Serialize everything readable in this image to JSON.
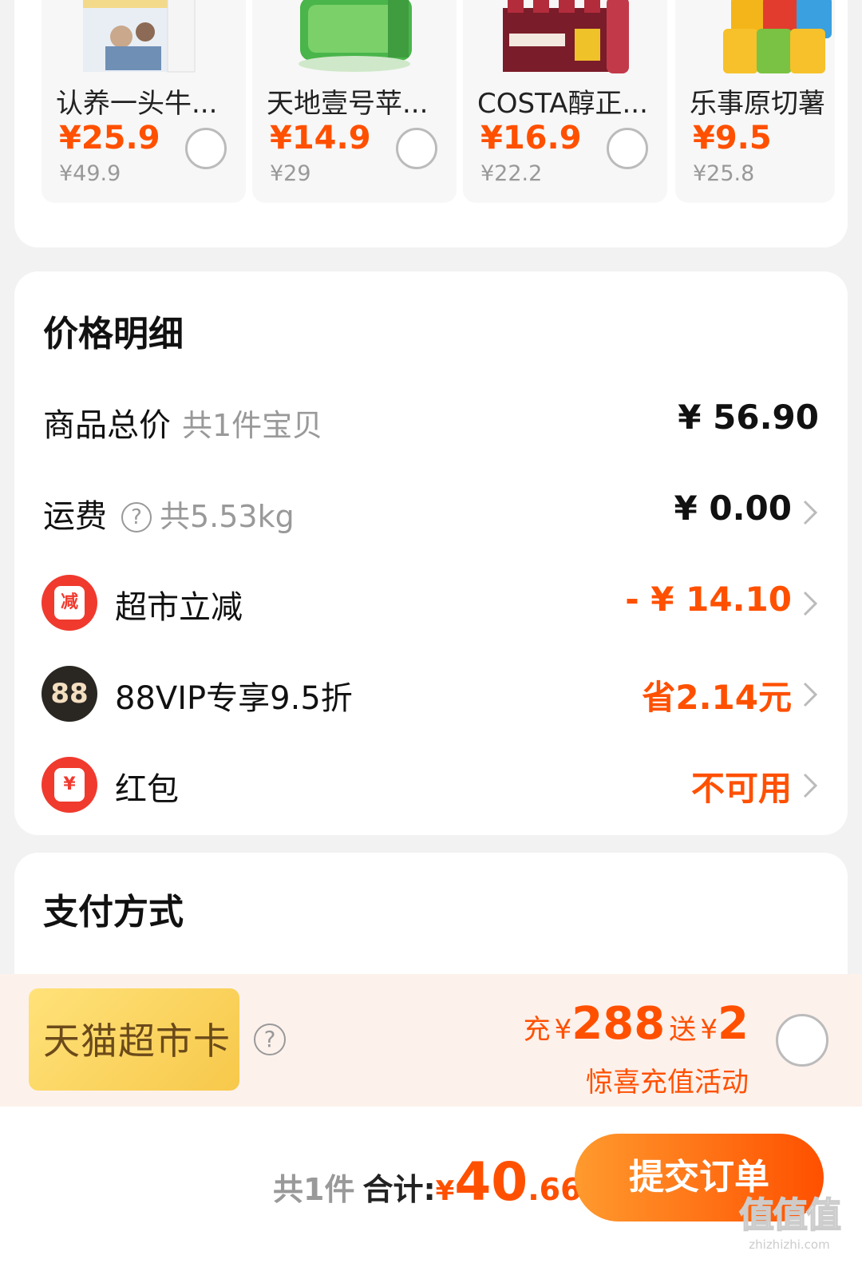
{
  "recommendations": [
    {
      "name": "认养一头牛...",
      "price": "¥25.9",
      "orig": "¥49.9"
    },
    {
      "name": "天地壹号苹...",
      "price": "¥14.9",
      "orig": "¥29"
    },
    {
      "name": "COSTA醇正...",
      "price": "¥16.9",
      "orig": "¥22.2"
    },
    {
      "name": "乐事原切薯",
      "price": "¥9.5",
      "orig": "¥25.8"
    }
  ],
  "detail": {
    "title": "价格明细",
    "goods_label": "商品总价",
    "goods_count": "共1件宝贝",
    "goods_value": "¥ 56.90",
    "ship_label": "运费",
    "ship_q": "?",
    "ship_weight": "共5.53kg",
    "ship_value": "¥ 0.00",
    "market_badge": "减",
    "market_label": "超市立减",
    "market_value": "- ¥ 14.10",
    "vip_badge": "88",
    "vip_label": "88VIP专享9.5折",
    "vip_value": "省2.14元",
    "hb_badge": "¥",
    "hb_label": "红包",
    "hb_value": "不可用"
  },
  "payment": {
    "title": "支付方式"
  },
  "promo": {
    "card_label": "天猫超市卡",
    "q": "?",
    "charge_word": "充",
    "currency": "¥",
    "charge_amount": "288",
    "gift_word": "送",
    "gift_amount": "2",
    "note": "惊喜充值活动"
  },
  "footer": {
    "count": "共1件",
    "total_label": "合计:",
    "currency": "¥",
    "total_int": "40",
    "total_dec": ".66",
    "submit": "提交订单",
    "watermark_cn": "值值值",
    "watermark_url": "zhizhizhi.com"
  },
  "colors": {
    "accent": "#ff5000",
    "badge_red": "#f03a2e",
    "promo_bg": "#fdf1ec"
  }
}
